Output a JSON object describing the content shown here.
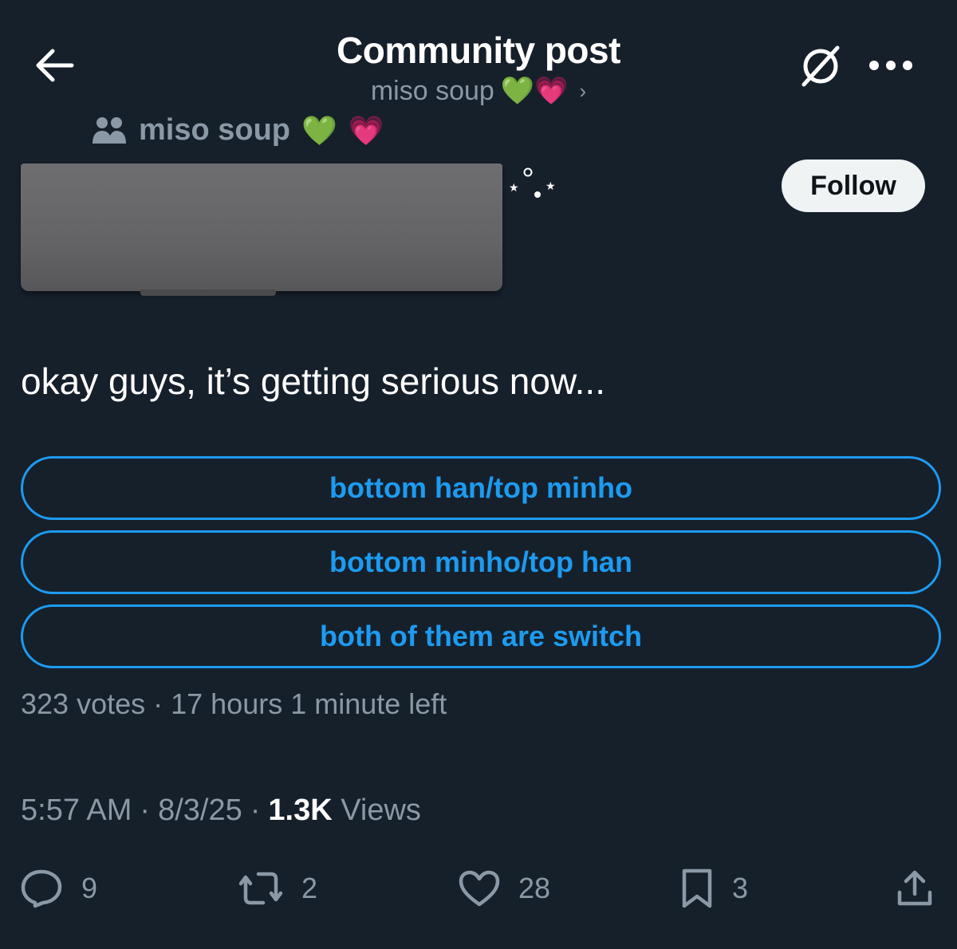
{
  "header": {
    "title": "Community post",
    "subtitle": "miso soup",
    "subtitle_emoji": "💚💗",
    "chevron": "›",
    "back_icon": "arrow-left-icon",
    "grok_icon": "grok-icon",
    "more_icon": "more-horizontal-icon"
  },
  "community": {
    "icon": "community-people-icon",
    "name": "miso soup",
    "emoji_green": "💚",
    "emoji_pink": "💗"
  },
  "author": {
    "redacted": true,
    "follow_label": "Follow"
  },
  "post": {
    "text": "okay guys, it’s getting serious now..."
  },
  "poll": {
    "options": [
      "bottom han/top minho",
      "bottom minho/top han",
      "both of them are switch"
    ],
    "meta": "323 votes · 17 hours 1 minute left"
  },
  "timestamp": {
    "time": "5:57 AM",
    "sep1": "·",
    "date": "8/3/25",
    "sep2": "·",
    "views_count": "1.3K",
    "views_label": "Views"
  },
  "actions": {
    "replies": "9",
    "reposts": "2",
    "likes": "28",
    "bookmarks": "3"
  },
  "colors": {
    "background": "#16202b",
    "accent": "#1d9bf0",
    "muted": "#8b98a5",
    "text": "#ffffff"
  }
}
